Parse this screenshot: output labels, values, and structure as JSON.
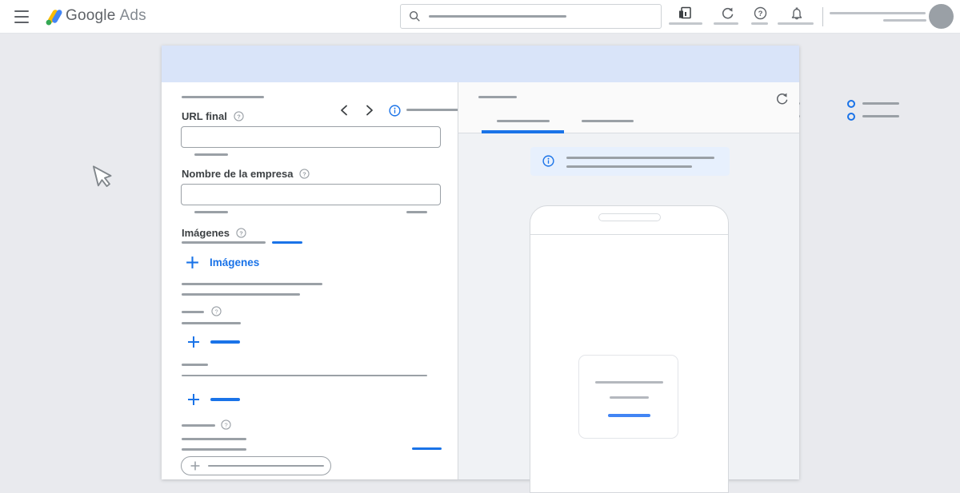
{
  "colors": {
    "accent_blue": "#1a73e8",
    "step_bar_bg": "#d9e4f9",
    "banner_bg": "#e7f0fd",
    "page_bg": "#e9eaee",
    "preview_bg": "#f0f2f5",
    "placeholder_gray": "#9aa0a6",
    "logo_blue": "#4285f4",
    "logo_yellow": "#fbbc04",
    "logo_green": "#34a853",
    "preview_card_blue": "#4285f4"
  },
  "topbar": {
    "brand_primary": "Google",
    "brand_secondary": "Ads",
    "search_value": ""
  },
  "icons": {
    "menu": "hamburger",
    "search": "magnifier",
    "reports": "chart-window",
    "refresh": "circular-arrow",
    "help": "question-circle",
    "notifications": "bell",
    "back": "chevron-left",
    "forward": "chevron-right",
    "info": "i-circle",
    "add": "plus",
    "cursor": "pointer-arrow"
  },
  "wizard": {
    "form": {
      "final_url": {
        "label": "URL final",
        "value": ""
      },
      "business_name": {
        "label": "Nombre de la empresa",
        "value": ""
      },
      "images": {
        "label": "Imágenes",
        "add_button_label": "Imágenes"
      }
    }
  }
}
